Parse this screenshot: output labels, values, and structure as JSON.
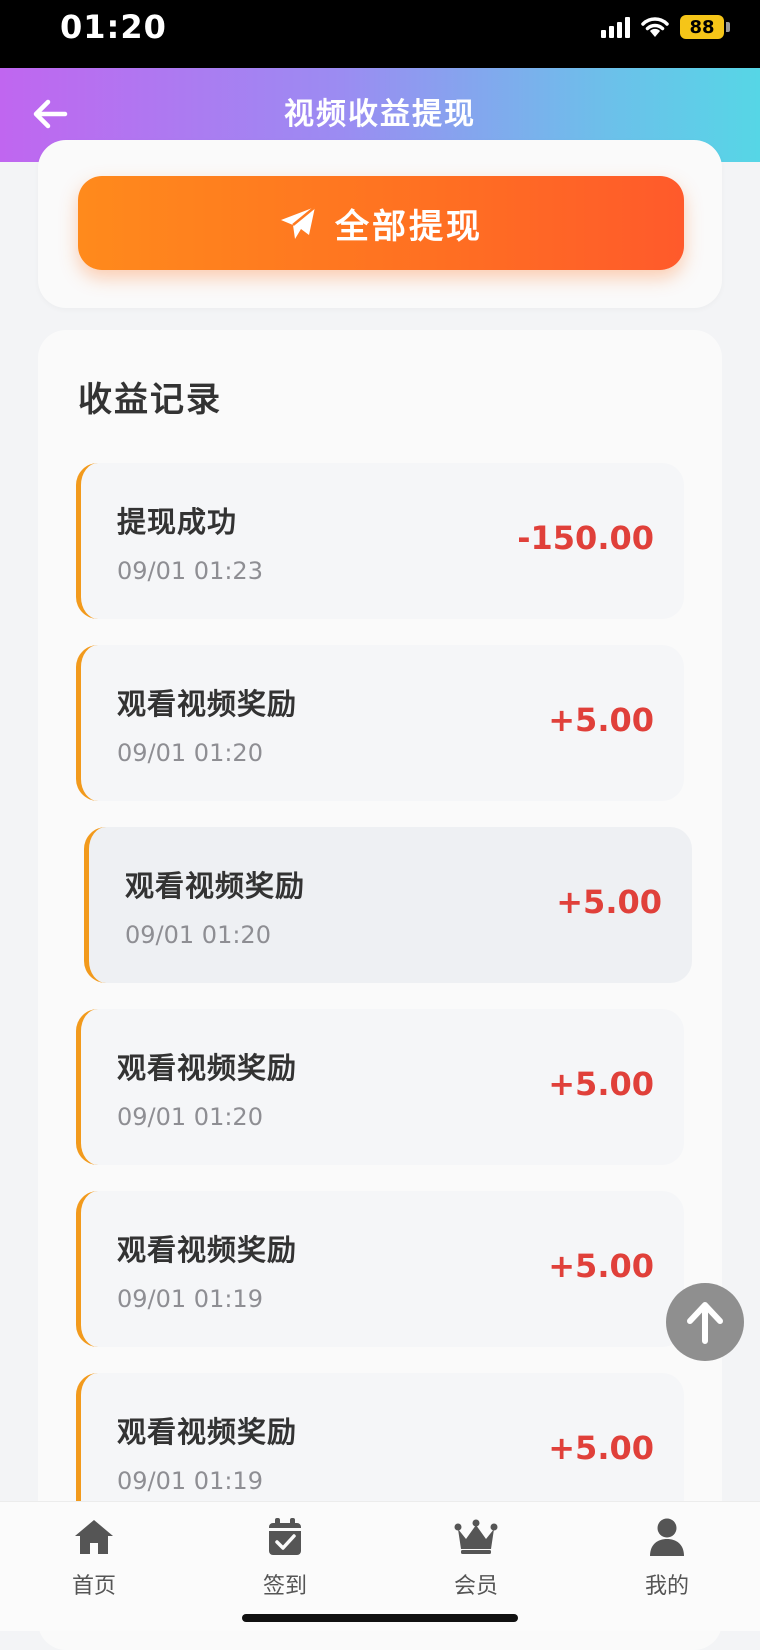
{
  "status_bar": {
    "time": "01:20",
    "battery": "88"
  },
  "header": {
    "title": "视频收益提现"
  },
  "withdraw": {
    "button_label": "全部提现"
  },
  "records": {
    "section_title": "收益记录",
    "items": [
      {
        "title": "提现成功",
        "time": "09/01 01:23",
        "amount": "-150.00"
      },
      {
        "title": "观看视频奖励",
        "time": "09/01 01:20",
        "amount": "+5.00"
      },
      {
        "title": "观看视频奖励",
        "time": "09/01 01:20",
        "amount": "+5.00"
      },
      {
        "title": "观看视频奖励",
        "time": "09/01 01:20",
        "amount": "+5.00"
      },
      {
        "title": "观看视频奖励",
        "time": "09/01 01:19",
        "amount": "+5.00"
      },
      {
        "title": "观看视频奖励",
        "time": "09/01 01:19",
        "amount": "+5.00"
      }
    ]
  },
  "tabbar": {
    "items": [
      {
        "label": "首页",
        "icon": "home-icon"
      },
      {
        "label": "签到",
        "icon": "calendar-check-icon"
      },
      {
        "label": "会员",
        "icon": "crown-icon"
      },
      {
        "label": "我的",
        "icon": "user-icon"
      }
    ]
  },
  "colors": {
    "accent_orange": "#ff7a20",
    "amount_red": "#e0403a",
    "record_border": "#f29a1c"
  }
}
